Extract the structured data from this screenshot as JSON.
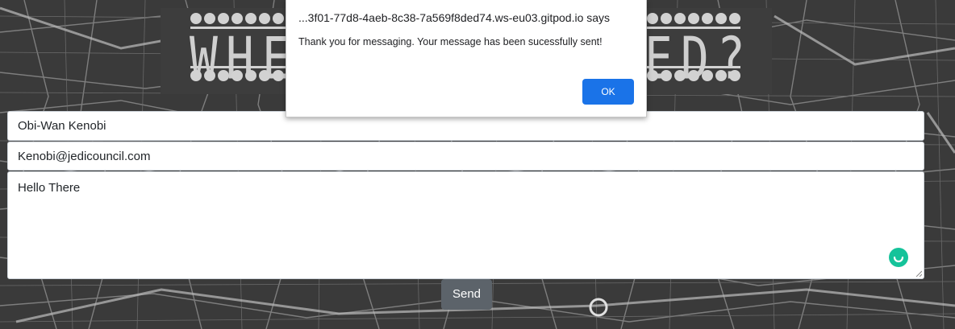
{
  "banner": {
    "left_text": "WHE",
    "right_text": "ED?"
  },
  "form": {
    "name_value": "Obi-Wan Kenobi",
    "email_value": "Kenobi@jedicouncil.com",
    "message_value": "Hello There",
    "send_label": "Send"
  },
  "dialog": {
    "origin": "...3f01-77d8-4aeb-8c38-7a569f8ded74.ws-eu03.gitpod.io says",
    "message": "Thank you for messaging. Your message has been sucessfully sent!",
    "ok_label": "OK"
  },
  "colors": {
    "map_background": "#3a3a3a",
    "map_streets": "#9a9a9a",
    "ok_button": "#1a73e8",
    "send_button": "#5c636a",
    "grammarly": "#15c39a"
  },
  "icons": {
    "grammarly": "grammarly-icon"
  }
}
